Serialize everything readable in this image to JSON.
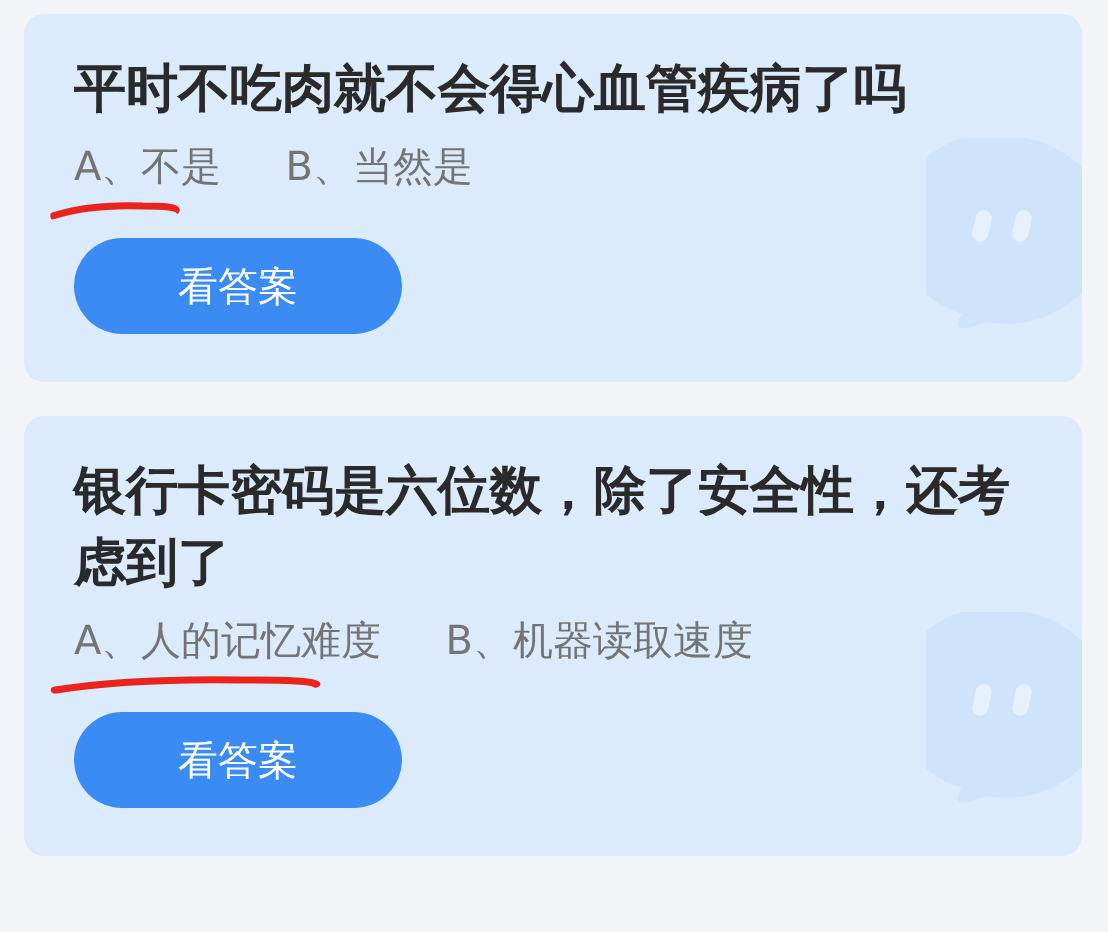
{
  "questions": [
    {
      "title": "平时不吃肉就不会得心血管疾病了吗",
      "options": [
        {
          "text": "A、不是",
          "underlined": true
        },
        {
          "text": "B、当然是",
          "underlined": false
        }
      ],
      "button": "看答案"
    },
    {
      "title": "银行卡密码是六位数，除了安全性，还考虑到了",
      "options": [
        {
          "text": "A、人的记忆难度",
          "underlined": true
        },
        {
          "text": "B、机器读取速度",
          "underlined": false
        }
      ],
      "button": "看答案"
    }
  ]
}
